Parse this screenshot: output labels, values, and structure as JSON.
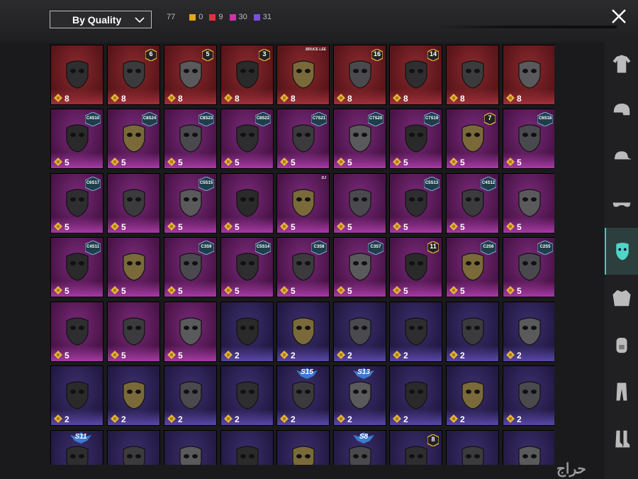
{
  "header": {
    "sort_label": "By Quality",
    "total_count": "77",
    "rarity_counts": [
      {
        "color": "#e5a320",
        "count": "0"
      },
      {
        "color": "#e0323c",
        "count": "9"
      },
      {
        "color": "#d42fb0",
        "count": "30"
      },
      {
        "color": "#7a4fe0",
        "count": "31"
      }
    ]
  },
  "sidebar": {
    "items": [
      {
        "name": "outfit",
        "icon": "outfit-icon"
      },
      {
        "name": "helmet",
        "icon": "helmet-icon"
      },
      {
        "name": "hat",
        "icon": "cap-icon"
      },
      {
        "name": "glasses",
        "icon": "glasses-icon"
      },
      {
        "name": "mask",
        "icon": "mask-icon",
        "active": true
      },
      {
        "name": "jacket",
        "icon": "jacket-icon"
      },
      {
        "name": "backpack",
        "icon": "backpack-icon"
      },
      {
        "name": "pants",
        "icon": "pants-icon"
      },
      {
        "name": "shoes",
        "icon": "shoes-icon"
      }
    ]
  },
  "items": [
    {
      "rarity": "red",
      "value": "8",
      "badge": ""
    },
    {
      "rarity": "red",
      "value": "8",
      "badge": "6"
    },
    {
      "rarity": "red",
      "value": "8",
      "badge": "5"
    },
    {
      "rarity": "red",
      "value": "8",
      "badge": "3"
    },
    {
      "rarity": "red",
      "value": "8",
      "brand": "BRUCE LEE"
    },
    {
      "rarity": "red",
      "value": "8",
      "badge": "16"
    },
    {
      "rarity": "red",
      "value": "8",
      "badge": "14"
    },
    {
      "rarity": "red",
      "value": "8",
      "badge": ""
    },
    {
      "rarity": "red",
      "value": "8",
      "badge": ""
    },
    {
      "rarity": "mag",
      "value": "5",
      "season": "C4S10"
    },
    {
      "rarity": "mag",
      "value": "5",
      "season": "C8S24"
    },
    {
      "rarity": "mag",
      "value": "5",
      "season": "C8S23"
    },
    {
      "rarity": "mag",
      "value": "5",
      "season": "C8S22"
    },
    {
      "rarity": "mag",
      "value": "5",
      "season": "C7S21"
    },
    {
      "rarity": "mag",
      "value": "5",
      "season": "C7S20"
    },
    {
      "rarity": "mag",
      "value": "5",
      "season": "C7S19"
    },
    {
      "rarity": "mag",
      "value": "5",
      "badge": "7"
    },
    {
      "rarity": "mag",
      "value": "5",
      "season": "C6S18"
    },
    {
      "rarity": "mag",
      "value": "5",
      "season": "C6S17"
    },
    {
      "rarity": "mag",
      "value": "5",
      "badge": ""
    },
    {
      "rarity": "mag",
      "value": "5",
      "season": "C5S15"
    },
    {
      "rarity": "mag",
      "value": "5",
      "badge": ""
    },
    {
      "rarity": "mag",
      "value": "5",
      "brand": "DJ"
    },
    {
      "rarity": "mag",
      "value": "5",
      "badge": ""
    },
    {
      "rarity": "mag",
      "value": "5",
      "season": "C5S13"
    },
    {
      "rarity": "mag",
      "value": "5",
      "season": "C4S12"
    },
    {
      "rarity": "mag",
      "value": "5",
      "badge": ""
    },
    {
      "rarity": "mag",
      "value": "5",
      "season": "C4S11"
    },
    {
      "rarity": "mag",
      "value": "5",
      "badge": ""
    },
    {
      "rarity": "mag",
      "value": "5",
      "season": "C3S9"
    },
    {
      "rarity": "mag",
      "value": "5",
      "season": "C5S14"
    },
    {
      "rarity": "mag",
      "value": "5",
      "season": "C3S8"
    },
    {
      "rarity": "mag",
      "value": "5",
      "season": "C3S7"
    },
    {
      "rarity": "mag",
      "value": "5",
      "badge": "11"
    },
    {
      "rarity": "mag",
      "value": "5",
      "season": "C2S6"
    },
    {
      "rarity": "mag",
      "value": "5",
      "season": "C2S5"
    },
    {
      "rarity": "mag",
      "value": "5",
      "badge": ""
    },
    {
      "rarity": "mag",
      "value": "5",
      "badge": ""
    },
    {
      "rarity": "mag",
      "value": "5",
      "badge": ""
    },
    {
      "rarity": "pur",
      "value": "2",
      "badge": ""
    },
    {
      "rarity": "pur",
      "value": "2",
      "badge": ""
    },
    {
      "rarity": "pur",
      "value": "2",
      "badge": ""
    },
    {
      "rarity": "pur",
      "value": "2",
      "badge": ""
    },
    {
      "rarity": "pur",
      "value": "2",
      "badge": ""
    },
    {
      "rarity": "pur",
      "value": "2",
      "badge": ""
    },
    {
      "rarity": "pur",
      "value": "2",
      "badge": ""
    },
    {
      "rarity": "pur",
      "value": "2",
      "badge": ""
    },
    {
      "rarity": "pur",
      "value": "2",
      "badge": ""
    },
    {
      "rarity": "pur",
      "value": "2",
      "badge": ""
    },
    {
      "rarity": "pur",
      "value": "2",
      "rank": "S15"
    },
    {
      "rarity": "pur",
      "value": "2",
      "rank": "S13"
    },
    {
      "rarity": "pur",
      "value": "2",
      "badge": ""
    },
    {
      "rarity": "pur",
      "value": "2",
      "badge": ""
    },
    {
      "rarity": "pur",
      "value": "2",
      "badge": ""
    },
    {
      "rarity": "pur",
      "value": "",
      "rank": "S11"
    },
    {
      "rarity": "pur",
      "value": "",
      "badge": ""
    },
    {
      "rarity": "pur",
      "value": "",
      "badge": ""
    },
    {
      "rarity": "pur",
      "value": "",
      "badge": ""
    },
    {
      "rarity": "pur",
      "value": "",
      "badge": ""
    },
    {
      "rarity": "pur",
      "value": "",
      "rank": "S8"
    },
    {
      "rarity": "pur",
      "value": "",
      "badge": "8"
    },
    {
      "rarity": "pur",
      "value": "",
      "badge": ""
    },
    {
      "rarity": "pur",
      "value": "",
      "badge": ""
    }
  ],
  "watermark": "حراج"
}
